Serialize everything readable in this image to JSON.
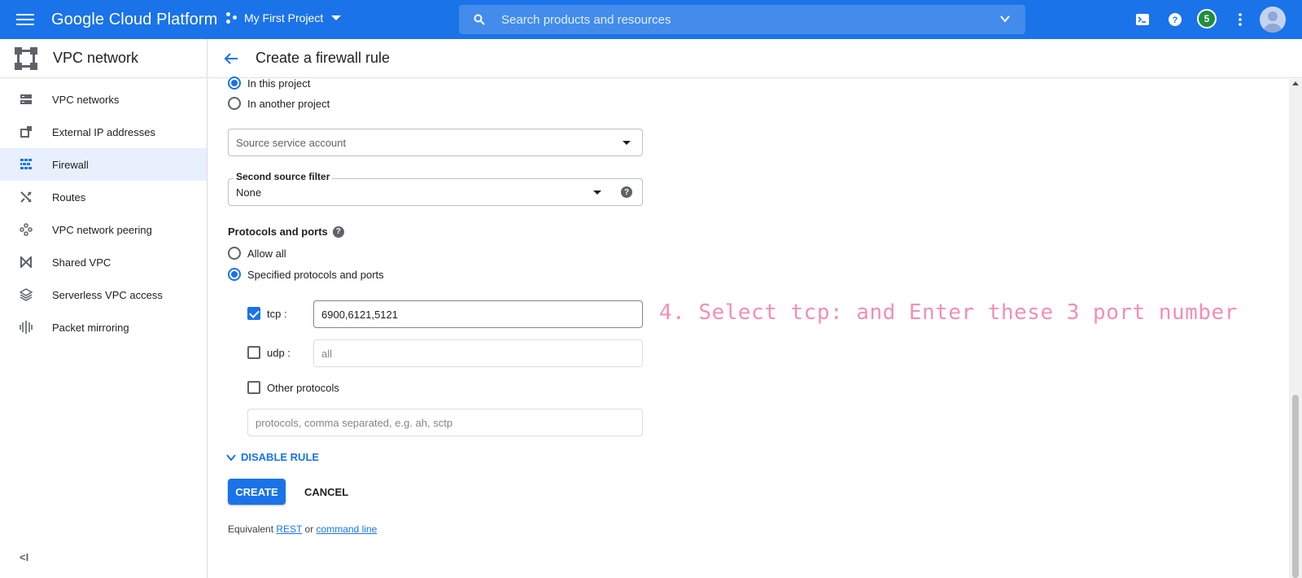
{
  "topbar": {
    "brand": "Google Cloud Platform",
    "project": "My First Project",
    "search_placeholder": "Search products and resources",
    "notification_count": "5",
    "accent_color": "#1a73e8"
  },
  "sidebar": {
    "title": "VPC network",
    "items": [
      {
        "label": "VPC networks",
        "icon": "vpc-networks-icon"
      },
      {
        "label": "External IP addresses",
        "icon": "external-ip-icon"
      },
      {
        "label": "Firewall",
        "icon": "firewall-icon",
        "active": true
      },
      {
        "label": "Routes",
        "icon": "routes-icon"
      },
      {
        "label": "VPC network peering",
        "icon": "peering-icon"
      },
      {
        "label": "Shared VPC",
        "icon": "shared-vpc-icon"
      },
      {
        "label": "Serverless VPC access",
        "icon": "serverless-icon"
      },
      {
        "label": "Packet mirroring",
        "icon": "packet-mirroring-icon"
      }
    ],
    "collapse_label": "<I"
  },
  "main": {
    "title": "Create a firewall rule",
    "project_scope": {
      "option_this": "In this project",
      "option_another": "In another project",
      "selected": "In this project"
    },
    "source_service_account": {
      "placeholder": "Source service account"
    },
    "second_source_filter": {
      "label": "Second source filter",
      "value": "None"
    },
    "protocols": {
      "label": "Protocols and ports",
      "option_allow_all": "Allow all",
      "option_specified": "Specified protocols and ports",
      "selected": "Specified protocols and ports",
      "tcp": {
        "label": "tcp :",
        "checked": true,
        "value": "6900,6121,5121"
      },
      "udp": {
        "label": "udp :",
        "checked": false,
        "placeholder": "all"
      },
      "other": {
        "label": "Other protocols",
        "checked": false,
        "placeholder": "protocols, comma separated, e.g. ah, sctp"
      }
    },
    "annotation": "4. Select tcp: and Enter these 3 port number",
    "disable_rule": "DISABLE RULE",
    "create_button": "CREATE",
    "cancel_button": "CANCEL",
    "equivalent": {
      "prefix": "Equivalent",
      "rest": "REST",
      "or": "or",
      "command_line": "command line"
    }
  }
}
